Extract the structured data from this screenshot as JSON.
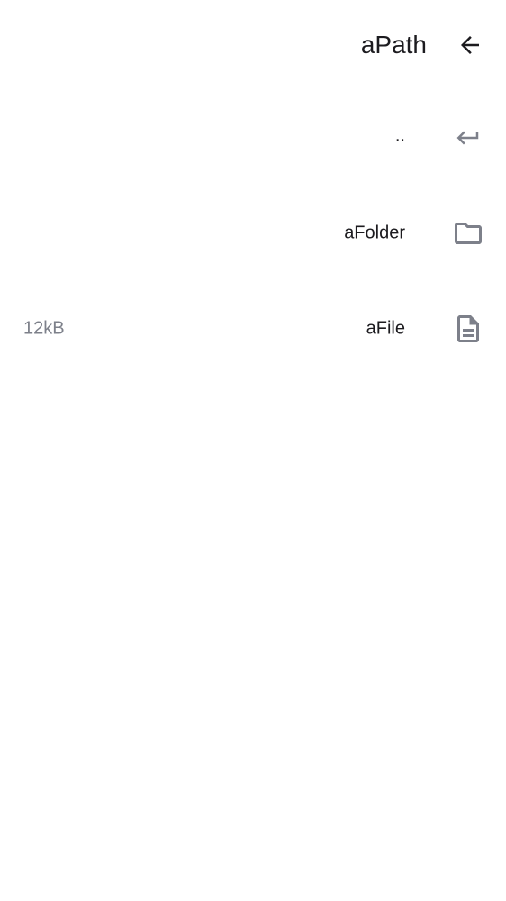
{
  "app_bar": {
    "title": "aPath",
    "back_icon": "arrow-back-icon"
  },
  "entries": [
    {
      "name": "..",
      "size": "",
      "icon": "subdirectory-return-icon",
      "kind": "parent"
    },
    {
      "name": "aFolder",
      "size": "",
      "icon": "folder-icon",
      "kind": "folder"
    },
    {
      "name": "aFile",
      "size": "12kB",
      "icon": "file-document-icon",
      "kind": "file"
    }
  ],
  "colors": {
    "text_primary": "#1c1b1f",
    "text_secondary": "#7d808a",
    "icon_gray": "#7d808a"
  }
}
